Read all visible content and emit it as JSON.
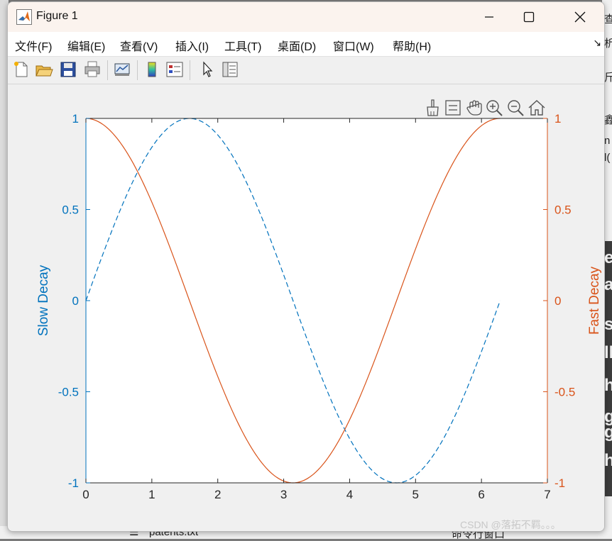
{
  "window": {
    "title": "Figure 1",
    "minimize_icon": "minimize-icon",
    "maximize_icon": "maximize-icon",
    "close_icon": "close-icon"
  },
  "menu": [
    "文件(F)",
    "编辑(E)",
    "查看(V)",
    "插入(I)",
    "工具(T)",
    "桌面(D)",
    "窗口(W)",
    "帮助(H)"
  ],
  "toolbar": [
    "new-figure-icon",
    "open-file-icon",
    "save-icon",
    "print-icon",
    "link-plot-icon",
    "colorbar-icon",
    "legend-icon",
    "pointer-icon",
    "property-inspector-icon"
  ],
  "axes_toolbar": [
    "brush-icon",
    "data-tips-icon",
    "pan-icon",
    "zoom-in-icon",
    "zoom-out-icon",
    "home-icon"
  ],
  "background": {
    "bottom_file": "patents.txt",
    "bottom_right": "命令行窗口",
    "right_glyphs": [
      "查",
      "析",
      "斤",
      "鑫",
      "n",
      "l(",
      "e",
      "a",
      "s",
      "ll",
      "h",
      "g",
      "g",
      "h"
    ]
  },
  "watermark": "CSDN @落拓不羁。。。",
  "colors": {
    "left_axis": "#0072BD",
    "right_axis": "#D95319"
  },
  "chart_data": {
    "type": "line",
    "xlim": [
      0,
      7
    ],
    "xticks": [
      "0",
      "1",
      "2",
      "3",
      "4",
      "5",
      "6",
      "7"
    ],
    "left_axis": {
      "ylabel": "Slow Decay",
      "ylim": [
        -1,
        1
      ],
      "yticks": [
        "-1",
        "-0.5",
        "0",
        "0.5",
        "1"
      ]
    },
    "right_axis": {
      "ylabel": "Fast Decay",
      "ylim": [
        -1,
        1
      ],
      "yticks": [
        "-1",
        "-0.5",
        "0",
        "0.5",
        "1"
      ]
    },
    "grid": false,
    "series": [
      {
        "axis": "left",
        "style": "dashed",
        "color": "#0072BD",
        "x": [
          0,
          0.3927,
          0.7854,
          1.1781,
          1.5708,
          1.9635,
          2.3562,
          2.7489,
          3.1416,
          3.5343,
          3.927,
          4.3197,
          4.7124,
          5.1051,
          5.4978,
          5.8905,
          6.2832
        ],
        "y": [
          0,
          0.3827,
          0.7071,
          0.9239,
          1,
          0.9239,
          0.7071,
          0.3827,
          0,
          -0.3827,
          -0.7071,
          -0.9239,
          -1,
          -0.9239,
          -0.7071,
          -0.3827,
          0
        ]
      },
      {
        "axis": "right",
        "style": "solid",
        "color": "#D95319",
        "x": [
          0,
          0.3927,
          0.7854,
          1.1781,
          1.5708,
          1.9635,
          2.3562,
          2.7489,
          3.1416,
          3.5343,
          3.927,
          4.3197,
          4.7124,
          5.1051,
          5.4978,
          5.8905,
          6.2832
        ],
        "y": [
          1,
          0.9239,
          0.7071,
          0.3827,
          0,
          -0.3827,
          -0.7071,
          -0.9239,
          -1,
          -0.9239,
          -0.7071,
          -0.3827,
          0,
          0.3827,
          0.7071,
          0.9239,
          1
        ]
      }
    ]
  }
}
